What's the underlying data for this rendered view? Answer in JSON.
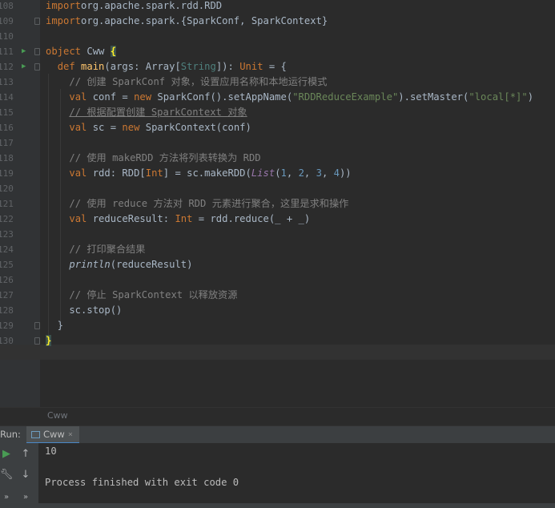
{
  "editor": {
    "lines": [
      {
        "num": "108",
        "tokens": [
          [
            "kw",
            "import"
          ],
          [
            "",
            "org.apache.spark.rdd.RDD"
          ]
        ]
      },
      {
        "num": "109",
        "tokens": [
          [
            "kw",
            "import"
          ],
          [
            "",
            "org.apache.spark.{SparkConf, SparkContext}"
          ]
        ]
      },
      {
        "num": "110",
        "tokens": []
      },
      {
        "num": "111",
        "tokens": [
          [
            "kw",
            "object"
          ],
          [
            "",
            " Cww "
          ],
          [
            "brace-y",
            "{"
          ]
        ]
      },
      {
        "num": "112",
        "tokens": [
          [
            "",
            "  "
          ],
          [
            "kw",
            "def"
          ],
          [
            "",
            " "
          ],
          [
            "fn",
            "main"
          ],
          [
            "",
            "(args: Array["
          ],
          [
            "ty",
            "String"
          ],
          [
            "",
            "]): "
          ],
          [
            "kw",
            "Unit"
          ],
          [
            "",
            " = {"
          ]
        ]
      },
      {
        "num": "113",
        "tokens": [
          [
            "",
            "    "
          ],
          [
            "cm",
            "// 创建 SparkConf 对象，设置应用名称和本地运行模式"
          ]
        ]
      },
      {
        "num": "114",
        "tokens": [
          [
            "",
            "    "
          ],
          [
            "kw",
            "val"
          ],
          [
            "",
            " conf = "
          ],
          [
            "kw",
            "new"
          ],
          [
            "",
            " SparkConf().setAppName("
          ],
          [
            "str",
            "\"RDDReduceExample\""
          ],
          [
            "",
            ").setMaster("
          ],
          [
            "str",
            "\"local[*]\""
          ],
          [
            "",
            ")"
          ]
        ]
      },
      {
        "num": "115",
        "tokens": [
          [
            "",
            "    "
          ],
          [
            "cm underline",
            "// 根据配置创建 SparkContext 对象"
          ]
        ]
      },
      {
        "num": "116",
        "tokens": [
          [
            "",
            "    "
          ],
          [
            "kw",
            "val"
          ],
          [
            "",
            " sc = "
          ],
          [
            "kw",
            "new"
          ],
          [
            "",
            " SparkContext(conf)"
          ]
        ]
      },
      {
        "num": "117",
        "tokens": []
      },
      {
        "num": "118",
        "tokens": [
          [
            "",
            "    "
          ],
          [
            "cm",
            "// 使用 makeRDD 方法将列表转换为 RDD"
          ]
        ]
      },
      {
        "num": "119",
        "tokens": [
          [
            "",
            "    "
          ],
          [
            "kw",
            "val"
          ],
          [
            "",
            " rdd: RDD["
          ],
          [
            "kw",
            "Int"
          ],
          [
            "",
            "] = sc.makeRDD("
          ],
          [
            "it",
            "List"
          ],
          [
            "",
            "("
          ],
          [
            "num",
            "1"
          ],
          [
            "",
            ", "
          ],
          [
            "num",
            "2"
          ],
          [
            "",
            ", "
          ],
          [
            "num",
            "3"
          ],
          [
            "",
            ", "
          ],
          [
            "num",
            "4"
          ],
          [
            "",
            "))"
          ]
        ]
      },
      {
        "num": "120",
        "tokens": []
      },
      {
        "num": "121",
        "tokens": [
          [
            "",
            "    "
          ],
          [
            "cm",
            "// 使用 reduce 方法对 RDD 元素进行聚合，这里是求和操作"
          ]
        ]
      },
      {
        "num": "122",
        "tokens": [
          [
            "",
            "    "
          ],
          [
            "kw",
            "val"
          ],
          [
            "",
            " reduceResult: "
          ],
          [
            "kw",
            "Int"
          ],
          [
            "",
            " = rdd.reduce(_ + _)"
          ]
        ]
      },
      {
        "num": "123",
        "tokens": []
      },
      {
        "num": "124",
        "tokens": [
          [
            "",
            "    "
          ],
          [
            "cm",
            "// 打印聚合结果"
          ]
        ]
      },
      {
        "num": "125",
        "tokens": [
          [
            "",
            "    "
          ],
          [
            "pl",
            "println"
          ],
          [
            "",
            "(reduceResult)"
          ]
        ]
      },
      {
        "num": "126",
        "tokens": []
      },
      {
        "num": "127",
        "tokens": [
          [
            "",
            "    "
          ],
          [
            "cm",
            "// 停止 SparkContext 以释放资源"
          ]
        ]
      },
      {
        "num": "128",
        "tokens": [
          [
            "",
            "    sc.stop()"
          ]
        ]
      },
      {
        "num": "129",
        "tokens": [
          [
            "",
            "  }"
          ]
        ]
      },
      {
        "num": "130",
        "tokens": [
          [
            "brace-y",
            "}"
          ]
        ]
      }
    ]
  },
  "breadcrumb": "Cww",
  "run_panel": {
    "label": "Run:",
    "tab_label": "Cww",
    "tab_close": "×",
    "output": [
      "10",
      "",
      "Process finished with exit code 0"
    ]
  }
}
